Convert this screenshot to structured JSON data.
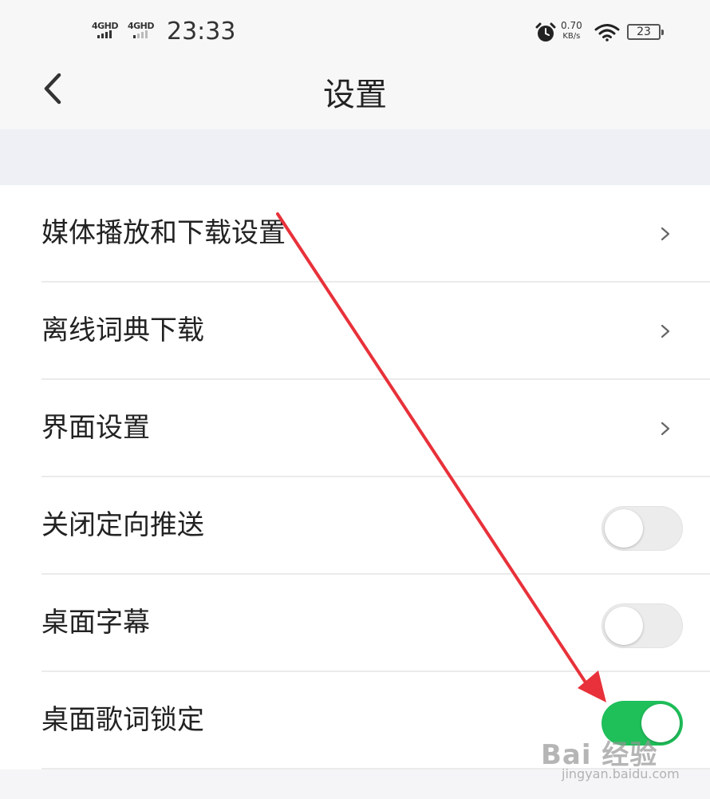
{
  "status_bar": {
    "signal1": "4GHD",
    "signal2": "4GHD",
    "time": "23:33",
    "net_speed_value": "0.70",
    "net_speed_unit": "KB/s",
    "battery": "23",
    "icons": [
      "alarm-icon",
      "wifi-icon",
      "battery-icon"
    ]
  },
  "header": {
    "title": "设置",
    "back_icon": "chevron-left-icon"
  },
  "settings": [
    {
      "label": "媒体播放和下载设置",
      "control": "chevron"
    },
    {
      "label": "离线词典下载",
      "control": "chevron"
    },
    {
      "label": "界面设置",
      "control": "chevron"
    },
    {
      "label": "关闭定向推送",
      "control": "toggle",
      "on": false
    },
    {
      "label": "桌面字幕",
      "control": "toggle",
      "on": false
    },
    {
      "label": "桌面歌词锁定",
      "control": "toggle",
      "on": true
    }
  ],
  "colors": {
    "toggle_on": "#1fbf5a",
    "toggle_off": "#ececec",
    "annotation_arrow": "#e8313a"
  },
  "watermark": {
    "main": "Bai 经验",
    "sub": "jingyan.baidu.com"
  }
}
